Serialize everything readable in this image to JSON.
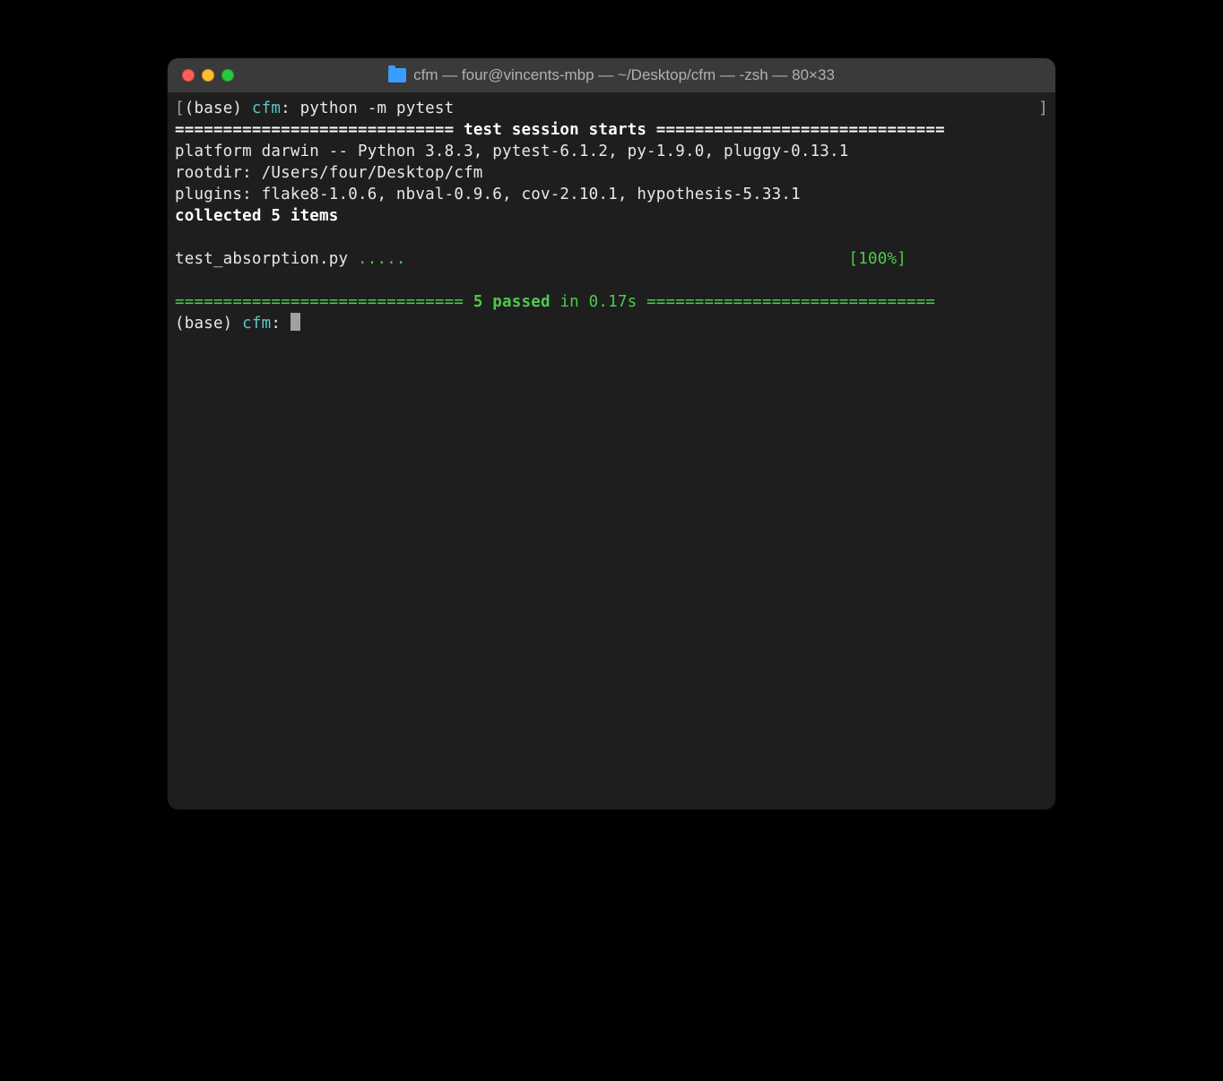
{
  "titlebar": {
    "title": "cfm — four@vincents-mbp — ~/Desktop/cfm — -zsh — 80×33"
  },
  "prompt1": {
    "bracket_open": "[",
    "env": "(base) ",
    "dir": "cfm",
    "colon": ": ",
    "command": "python -m pytest",
    "bracket_close": "]"
  },
  "session_header": {
    "left": "============================= ",
    "text": "test session starts",
    "right": " =============================="
  },
  "platform_line": "platform darwin -- Python 3.8.3, pytest-6.1.2, py-1.9.0, pluggy-0.13.1",
  "rootdir_line": "rootdir: /Users/four/Desktop/cfm",
  "plugins_line": "plugins: flake8-1.0.6, nbval-0.9.6, cov-2.10.1, hypothesis-5.33.1",
  "collected_line": "collected 5 items",
  "test_run": {
    "file": "test_absorption.py ",
    "dots": ".....",
    "spacer": "                                              ",
    "percent": "[100%]"
  },
  "result_line": {
    "left": "============================== ",
    "passed": "5 passed",
    "time": " in 0.17s",
    "right": " =============================="
  },
  "prompt2": {
    "env": "(base) ",
    "dir": "cfm",
    "colon": ": "
  }
}
